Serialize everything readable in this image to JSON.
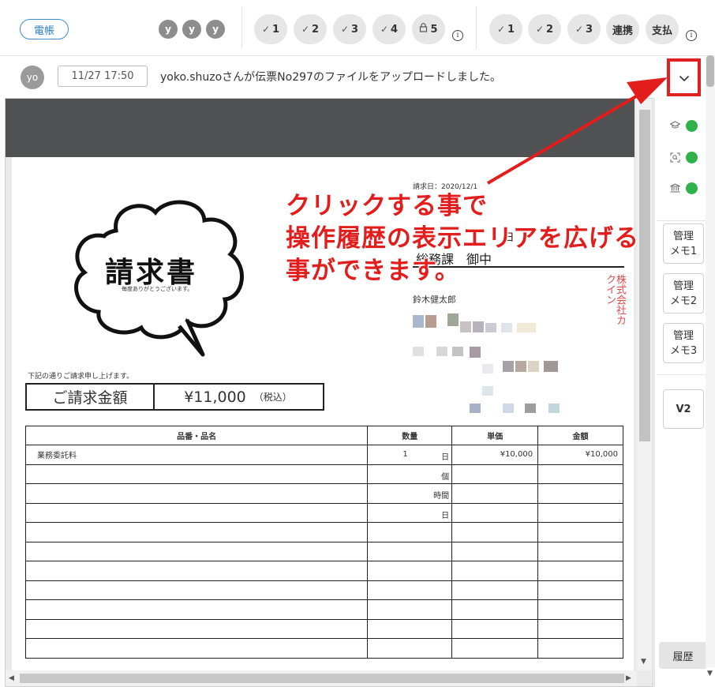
{
  "toolbar": {
    "tag_label": "電帳",
    "user_initials": [
      "y",
      "y",
      "y"
    ],
    "approval_steps": [
      {
        "label": "1",
        "icon": "check-icon"
      },
      {
        "label": "2",
        "icon": "check-icon"
      },
      {
        "label": "3",
        "icon": "check-icon"
      },
      {
        "label": "4",
        "icon": "check-icon"
      },
      {
        "label": "5",
        "icon": "lock-icon"
      }
    ],
    "process_steps": [
      {
        "label": "1",
        "icon": "check-icon"
      },
      {
        "label": "2",
        "icon": "check-icon"
      },
      {
        "label": "3",
        "icon": "check-icon"
      },
      {
        "label": "連携"
      },
      {
        "label": "支払"
      }
    ],
    "info_glyph": "i"
  },
  "notification": {
    "avatar": "yo",
    "timestamp": "11/27 17:50",
    "message": "yoko.shuzoさんが伝票No297のファイルをアップロードしました。",
    "expand_glyph": "⌄"
  },
  "invoice": {
    "title": "請求書",
    "title_sub": "毎度ありがとうございます。",
    "date": "請求日：2020/12/1",
    "to_line": "総務課　御中",
    "to_partial": "ヨ",
    "sender": "鈴木健太郎",
    "seal_text": "株式会社カクイン",
    "intro": "下記の通りご請求申し上げます。",
    "amount_label": "ご請求金額",
    "amount_value": "¥11,000",
    "amount_tax": "（税込）",
    "table": {
      "headers": [
        "品番・品名",
        "数量",
        "単価",
        "金額"
      ],
      "rows": [
        {
          "name": "業務委託料",
          "qty": "1",
          "unit": "日",
          "price": "¥10,000",
          "amount": "¥10,000"
        },
        {
          "name": "",
          "qty": "",
          "unit": "個",
          "price": "",
          "amount": ""
        },
        {
          "name": "",
          "qty": "",
          "unit": "時間",
          "price": "",
          "amount": ""
        },
        {
          "name": "",
          "qty": "",
          "unit": "日",
          "price": "",
          "amount": ""
        },
        {
          "name": "",
          "qty": "",
          "unit": "",
          "price": "",
          "amount": ""
        },
        {
          "name": "",
          "qty": "",
          "unit": "",
          "price": "",
          "amount": ""
        },
        {
          "name": "",
          "qty": "",
          "unit": "",
          "price": "",
          "amount": ""
        },
        {
          "name": "",
          "qty": "",
          "unit": "",
          "price": "",
          "amount": ""
        },
        {
          "name": "",
          "qty": "",
          "unit": "",
          "price": "",
          "amount": ""
        },
        {
          "name": "",
          "qty": "",
          "unit": "",
          "price": "",
          "amount": ""
        },
        {
          "name": "",
          "qty": "",
          "unit": "",
          "price": "",
          "amount": ""
        }
      ]
    }
  },
  "sidebar": {
    "status_icons": [
      "graduation-cap-icon",
      "scan-search-icon",
      "bank-icon"
    ],
    "memo_buttons": [
      {
        "line1": "管理",
        "line2": "メモ1"
      },
      {
        "line1": "管理",
        "line2": "メモ2"
      },
      {
        "line1": "管理",
        "line2": "メモ3"
      }
    ],
    "version_label": "V2",
    "history_label": "履歴"
  },
  "annotation": {
    "lines": [
      "クリックする事で",
      "操作履歴の表示エリアを広げる",
      "事ができます。"
    ],
    "color": "#e31c1c"
  },
  "colors": {
    "accent_blue": "#2a7fc9",
    "status_green": "#2fb24a",
    "annotation_red": "#e31c1c",
    "viewer_header": "#4f5153"
  }
}
